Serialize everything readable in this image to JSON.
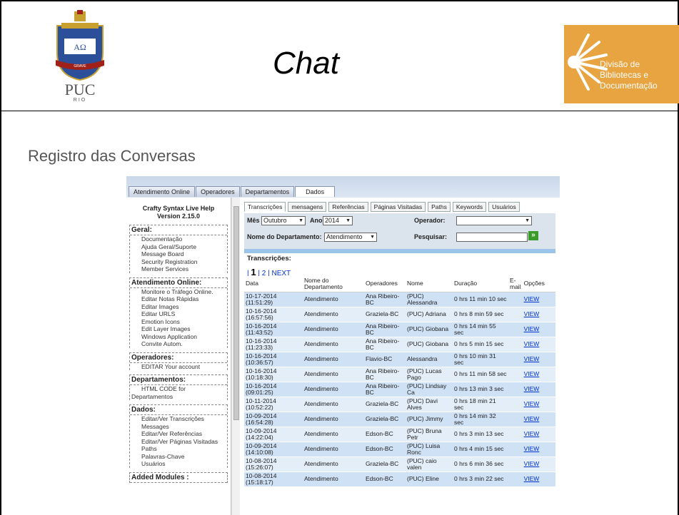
{
  "slide": {
    "title": "Chat",
    "subtitle": "Registro das Conversas",
    "puc_logo_text": "PUC",
    "puc_logo_subtext": "RIO",
    "div_logo_lines": [
      "Divisão de",
      "Bibliotecas e",
      "Documentação"
    ]
  },
  "app": {
    "main_tabs": [
      "Atendimento Online",
      "Operadores",
      "Departamentos",
      "Dados"
    ],
    "active_main_tab": "Dados",
    "title": "Crafty Syntax Live Help",
    "version_prefix": "Version ",
    "version": "2.15.0",
    "sidebar": [
      {
        "heading": "Geral:",
        "items": [
          "Documentação",
          "Ajuda Geral/Suporte",
          "Message Board",
          "Security Registration",
          "Member Services"
        ]
      },
      {
        "heading": "Atendimento Online:",
        "items": [
          "Monitore o Tráfego Online.",
          "Editar Notas Rápidas",
          "Editar Images",
          "Editar URLS",
          "Emotion Icons",
          "Edit Layer Images",
          "Windows Application",
          "Convite Autom."
        ]
      },
      {
        "heading": "Operadores:",
        "items": [
          "EDITAR Your account"
        ]
      },
      {
        "heading": "Departamentos:",
        "items": [
          "HTML CODE for",
          "Departamentos"
        ]
      },
      {
        "heading": "Dados:",
        "items": [
          "Editar/Ver Transcrições",
          "Messages",
          "Editar/Ver Referências",
          "Editar/Ver Páginas Visitadas",
          "Paths",
          "Palavras-Chave",
          "Usuários"
        ]
      },
      {
        "heading": "Added Modules :",
        "items": []
      }
    ],
    "sub_tabs": [
      "Transcrições",
      "mensagens",
      "Referências",
      "Páginas Visitadas",
      "Paths",
      "Keywords",
      "Usuários"
    ],
    "active_sub_tab": "Transcrições",
    "filters": {
      "mes_label": "Mês",
      "mes_value": "Outubro",
      "ano_label": "Ano",
      "ano_value": "2014",
      "operador_label": "Operador:",
      "operador_value": "",
      "dept_label": "Nome do Departamento:",
      "dept_value": "Atendimento",
      "pesquisar_label": "Pesquisar:",
      "pesquisar_value": ""
    },
    "transcricoes_label": "Transcrições:",
    "pager": {
      "prefix": "| ",
      "current": "1",
      "sep": " | ",
      "next_page": "2",
      "sep2": " | ",
      "next_label": "NEXT"
    },
    "table": {
      "columns": [
        "Data",
        "Nome do Departamento",
        "Operadores",
        "Nome",
        "Duração",
        "E-mail",
        "Opções"
      ],
      "rows": [
        [
          "10-17-2014 (11:51:29)",
          "Atendimento",
          "Ana Ribeiro-BC",
          "(PUC) Alessandra",
          "0 hrs 11 min 10 sec",
          "",
          "VIEW"
        ],
        [
          "10-16-2014 (16:57:56)",
          "Atendimento",
          "Graziela-BC",
          "(PUC) Adriana",
          "0 hrs 8 min 59 sec",
          "",
          "VIEW"
        ],
        [
          "10-16-2014 (11:43:52)",
          "Atendimento",
          "Ana Ribeiro-BC",
          "(PUC) Giobana",
          "0 hrs 14 min 55 sec",
          "",
          "VIEW"
        ],
        [
          "10-16-2014 (11:23:33)",
          "Atendimento",
          "Ana Ribeiro-BC",
          "(PUC) Giobana",
          "0 hrs 5 min 15 sec",
          "",
          "VIEW"
        ],
        [
          "10-16-2014 (10:36:57)",
          "Atendimento",
          "Flavio-BC",
          "Alessandra",
          "0 hrs 10 min 31 sec",
          "",
          "VIEW"
        ],
        [
          "10-16-2014 (10:18:30)",
          "Atendimento",
          "Ana Ribeiro-BC",
          "(PUC) Lucas Pago",
          "0 hrs 11 min 58 sec",
          "",
          "VIEW"
        ],
        [
          "10-16-2014 (09:01:25)",
          "Atendimento",
          "Ana Ribeiro-BC",
          "(PUC) Lindsay Ca",
          "0 hrs 13 min 3 sec",
          "",
          "VIEW"
        ],
        [
          "10-11-2014 (10:52:22)",
          "Atendimento",
          "Graziela-BC",
          "(PUC) Davi Alves",
          "0 hrs 18 min 21 sec",
          "",
          "VIEW"
        ],
        [
          "10-09-2014 (16:54:28)",
          "Atendimento",
          "Graziela-BC",
          "(PUC) Jimmy",
          "0 hrs 14 min 32 sec",
          "",
          "VIEW"
        ],
        [
          "10-09-2014 (14:22:04)",
          "Atendimento",
          "Edson-BC",
          "(PUC) Bruna Petr",
          "0 hrs 3 min 13 sec",
          "",
          "VIEW"
        ],
        [
          "10-09-2014 (14:10:08)",
          "Atendimento",
          "Edson-BC",
          "(PUC) Luisa Ronc",
          "0 hrs 4 min 15 sec",
          "",
          "VIEW"
        ],
        [
          "10-08-2014 (15:26:07)",
          "Atendimento",
          "Graziela-BC",
          "(PUC) caio valen",
          "0 hrs 6 min 36 sec",
          "",
          "VIEW"
        ],
        [
          "10-08-2014 (15:18:17)",
          "Atendimento",
          "Edson-BC",
          "(PUC) Eline",
          "0 hrs 3 min 22 sec",
          "",
          "VIEW"
        ]
      ]
    }
  }
}
